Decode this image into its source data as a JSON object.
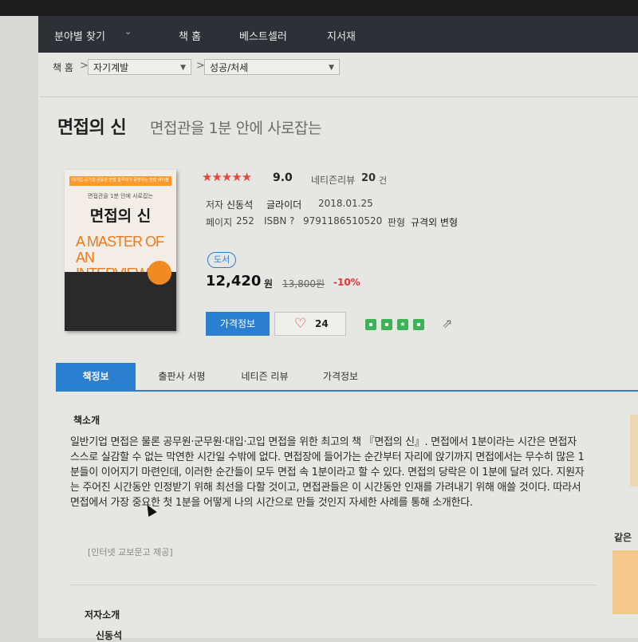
{
  "nav": {
    "category_finder": "분야별 찾기",
    "items": [
      "책 홈",
      "베스트셀러",
      "지서재"
    ]
  },
  "breadcrumb": {
    "home": "책 홈",
    "level1": "자기계발",
    "level2": "성공/처세"
  },
  "book": {
    "title": "면접의 신",
    "subtitle": "면접관을 1분 안에 사로잡는",
    "cover": {
      "band": "대기업·공기업·금융권 면접 합격자가 증명하는 면접 바이블",
      "small_title": "면접관을 1분 안에 사로잡는",
      "big_title": "면접의 신",
      "english": "A MASTER OF AN INTERVIEW"
    },
    "rating_stars": "★★★★★",
    "score": "9.0",
    "review_label": "네티즌리뷰",
    "review_count": "20",
    "review_unit": "건",
    "author_label": "저자",
    "author": "신동석",
    "publisher": "글라이더",
    "date": "2018.01.25",
    "pages_label": "페이지",
    "pages": "252",
    "isbn_label": "ISBN",
    "isbn_help": "?",
    "isbn": "9791186510520",
    "format_label": "판형",
    "format": "규격외 변형",
    "type_tag": "도서",
    "price": "12,420",
    "currency": "원",
    "original_price": "13,800원",
    "discount": "-10%",
    "price_button": "가격정보",
    "like_count": "24"
  },
  "tabs": [
    "책정보",
    "출판사 서평",
    "네티즌 리뷰",
    "가격정보"
  ],
  "intro": {
    "title": "책소개",
    "text": "일반기업 면접은 물론 공무원·군무원·대입·고입 면접을 위한 최고의 책 『면접의 신』. 면접에서 1분이라는 시간은 면접자 스스로 실감할 수 없는 막연한 시간일 수밖에 없다. 면접장에 들어가는 순간부터 자리에 앉기까지 면접에서는 무수히 많은 1분들이 이어지기 마련인데, 이러한 순간들이 모두 면접 속 1분이라고 할 수 있다. 면접의 당락은 이 1분에 달려 있다. 지원자는 주어진 시간동안 인정받기 위해 최선을 다할 것이고, 면접관들은 이 시간동안 인재를 가려내기 위해 애쓸 것이다. 따라서 면접에서 가장 중요한 첫 1분을 어떻게 나의 시간으로 만들 것인지 자세한 사례를 통해 소개한다.",
    "source": "[인터넷 교보문고 제공]"
  },
  "author_section": {
    "title": "저자소개",
    "name": "신동석"
  },
  "side": {
    "label": "같은"
  }
}
